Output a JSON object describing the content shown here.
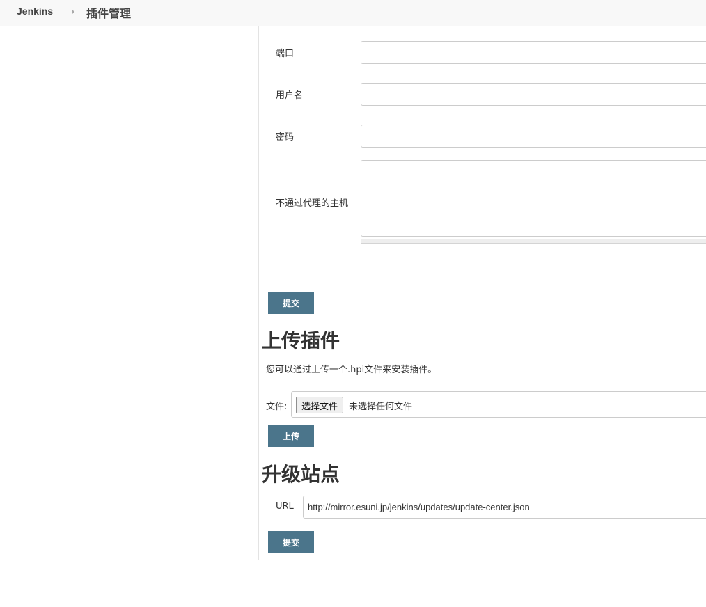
{
  "header": {
    "brand": "Jenkins",
    "breadcrumb": "插件管理"
  },
  "proxy": {
    "port_label": "端口",
    "port_value": "",
    "username_label": "用户名",
    "username_value": "",
    "password_label": "密码",
    "password_value": "",
    "no_proxy_label": "不通过代理的主机",
    "no_proxy_value": "",
    "submit_label": "提交"
  },
  "upload": {
    "heading": "上传插件",
    "description": "您可以通过上传一个.hpi文件来安装插件。",
    "file_label": "文件:",
    "choose_file_label": "选择文件",
    "no_file_text": "未选择任何文件",
    "upload_label": "上传"
  },
  "update_site": {
    "heading": "升级站点",
    "url_label": "URL",
    "url_value": "http://mirror.esuni.jp/jenkins/updates/update-center.json",
    "submit_label": "提交"
  },
  "colors": {
    "button": "#4b758b",
    "topbar": "#f8f8f8"
  }
}
